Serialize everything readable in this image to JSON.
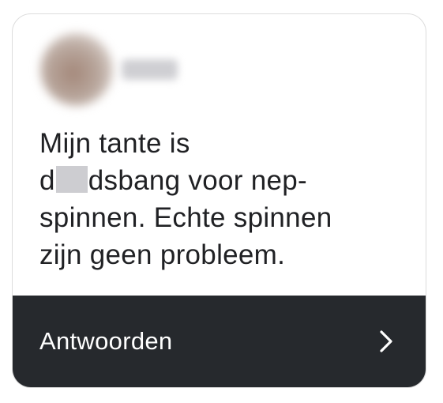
{
  "post": {
    "username": "elisoo",
    "message_line1": "Mijn tante is",
    "message_line2_pre": "d",
    "message_line2_post": "dsbang voor nep-",
    "message_line3": "spinnen. Echte spinnen",
    "message_line4": "zijn geen probleem."
  },
  "footer": {
    "reply_label": "Antwoorden",
    "chevron_icon": "chevron-right-icon"
  },
  "colors": {
    "footer_bg": "#26292d",
    "text": "#202124",
    "censor_block": "#cdcdd1"
  }
}
